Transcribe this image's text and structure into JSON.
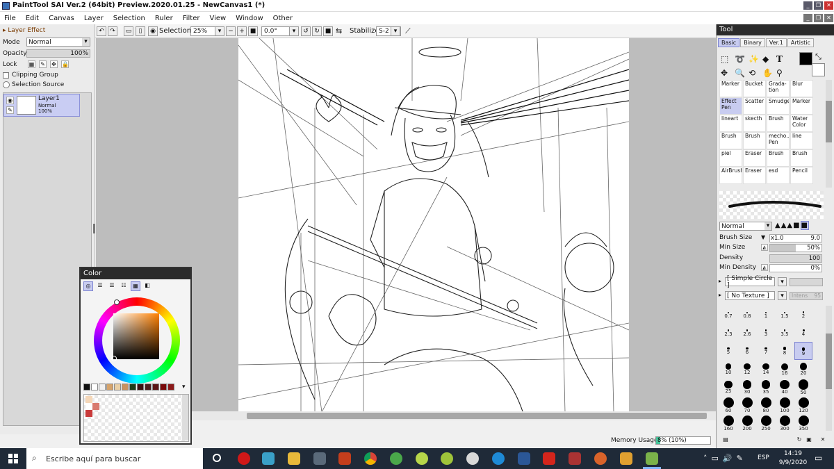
{
  "window": {
    "title": "PaintTool SAI Ver.2 (64bit) Preview.2020.01.25 - NewCanvas1 (*)"
  },
  "menu": [
    "File",
    "Edit",
    "Canvas",
    "Layer",
    "Selection",
    "Ruler",
    "Filter",
    "View",
    "Window",
    "Other"
  ],
  "left_panel": {
    "layer_effect": "Layer Effect",
    "mode_label": "Mode",
    "mode_value": "Normal",
    "opacity_label": "Opacity",
    "opacity_value": "100%",
    "lock_label": "Lock",
    "clipping_group": "Clipping Group",
    "selection_source": "Selection Source",
    "layer": {
      "name": "Layer1",
      "mode": "Normal",
      "opacity": "100%"
    }
  },
  "toolbar": {
    "selection_label": "Selection",
    "zoom": "25%",
    "rotation": "0.0°",
    "stabilizer_label": "Stabilizer",
    "stabilizer_value": "S-2"
  },
  "status": {
    "memory_label": "Memory Usage",
    "memory_value": "8% (10%)",
    "memory_fraction": 0.08
  },
  "tool_panel": {
    "title": "Tool",
    "tabs": [
      "Basic",
      "Binary",
      "Ver.1",
      "Artistic"
    ],
    "brushes": [
      [
        "Marker",
        "Bucket",
        "Grada-tion",
        "Blur"
      ],
      [
        "Effect Pen",
        "Scatter",
        "Smudge",
        "Marker"
      ],
      [
        "lineart",
        "skecth",
        "Brush",
        "Water Color"
      ],
      [
        "Brush",
        "Brush",
        "mecho... Pen",
        "line"
      ],
      [
        "piel",
        "Eraser",
        "Brush",
        "Brush"
      ],
      [
        "AirBrush",
        "Eraser",
        "esd",
        "Pencil"
      ]
    ],
    "blend_mode": "Normal",
    "brush_size_label": "Brush Size",
    "brush_size_mult": "x1.0",
    "brush_size_value": "9.0",
    "min_size_label": "Min Size",
    "min_size_value": "50%",
    "density_label": "Density",
    "density_value": "100",
    "min_density_label": "Min Density",
    "min_density_value": "0%",
    "shape": "[ Simple Circle ]",
    "texture": "[ No Texture ]",
    "intens_label": "Intens",
    "intens_value": "95",
    "sizes": [
      "0.7",
      "0.8",
      "1",
      "1.5",
      "2",
      "2.3",
      "2.6",
      "3",
      "3.5",
      "4",
      "5",
      "6",
      "7",
      "8",
      "9",
      "10",
      "12",
      "14",
      "16",
      "20",
      "25",
      "30",
      "35",
      "40",
      "50",
      "60",
      "70",
      "80",
      "100",
      "120",
      "160",
      "200",
      "250",
      "300",
      "350"
    ],
    "selected_size": "9"
  },
  "color_panel": {
    "title": "Color",
    "swatches": [
      "#111111",
      "#ffffff",
      "#f2f2f2",
      "#d6a36a",
      "#e9cfa6",
      "#c8915f",
      "#1c3d1a",
      "#3a1212",
      "#4a1d1d",
      "#5c1515",
      "#7a0a0a",
      "#8b1a1a"
    ],
    "custom": [
      "#f5d7b8",
      "#d97a6e",
      "#ffffff",
      "#c93b3b"
    ]
  },
  "taskbar": {
    "search_placeholder": "Escribe aquí para buscar",
    "lang": "ESP",
    "time": "14:19",
    "date": "9/9/2020"
  }
}
